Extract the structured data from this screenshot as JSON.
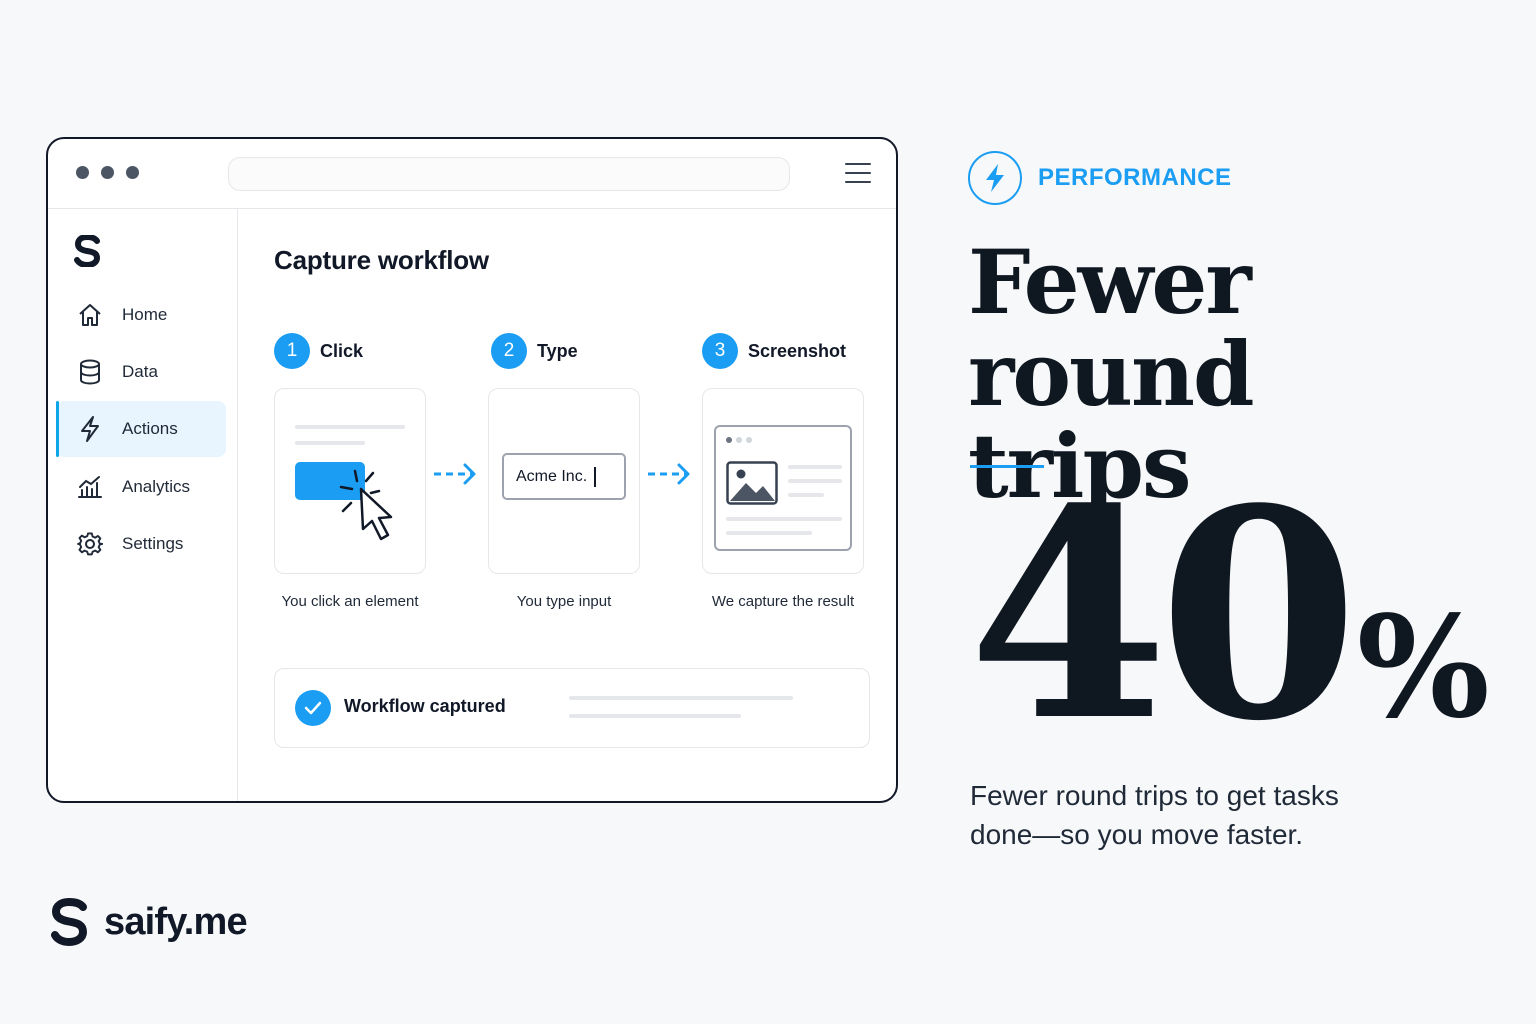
{
  "window": {
    "sidebar": {
      "items": [
        {
          "label": "Home",
          "icon": "home-icon"
        },
        {
          "label": "Data",
          "icon": "database-icon"
        },
        {
          "label": "Actions",
          "icon": "lightning-icon",
          "active": true
        },
        {
          "label": "Analytics",
          "icon": "chart-icon"
        },
        {
          "label": "Settings",
          "icon": "gear-icon"
        }
      ]
    },
    "main": {
      "title": "Capture workflow",
      "steps": [
        {
          "number": "1",
          "label": "Click",
          "caption": "You click an element"
        },
        {
          "number": "2",
          "label": "Type",
          "caption": "You type input",
          "input_value": "Acme Inc."
        },
        {
          "number": "3",
          "label": "Screenshot",
          "caption": "We capture the result"
        }
      ],
      "status": "Workflow captured"
    }
  },
  "feature": {
    "category": "PERFORMANCE",
    "headline_line1": "Fewer",
    "headline_line2": "round trips",
    "stat_number": "40",
    "stat_unit": "%",
    "description": "Fewer round trips to get tasks done—so you move faster."
  },
  "brand": {
    "name": "saify.me"
  },
  "colors": {
    "accent": "#1a9df2",
    "text": "#111827",
    "background": "#f7f8f9"
  }
}
